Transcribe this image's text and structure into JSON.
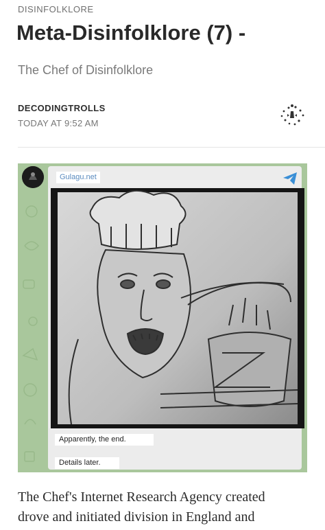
{
  "article": {
    "category": "DISINFOLKLORE",
    "title": "Meta-Disinfolklore (7) -",
    "subtitle": "The Chef of Disinfolklore",
    "author": "DECODINGTROLLS",
    "timestamp": "TODAY AT 9:52 AM",
    "body_line_1": "The Chef's Internet Research Agency created",
    "body_line_2": "drove and initiated division in England and"
  },
  "embed": {
    "channel_name": "Gulagu.net",
    "caption_1": "Apparently, the end.",
    "caption_2": "Details later.",
    "icons": [
      "channel-avatar",
      "telegram-share-icon"
    ]
  },
  "colors": {
    "title": "#292929",
    "telegram_background": "#a9c79c",
    "telegram_accent": "#3a8fd6",
    "channel_name": "#5a8bbf"
  }
}
